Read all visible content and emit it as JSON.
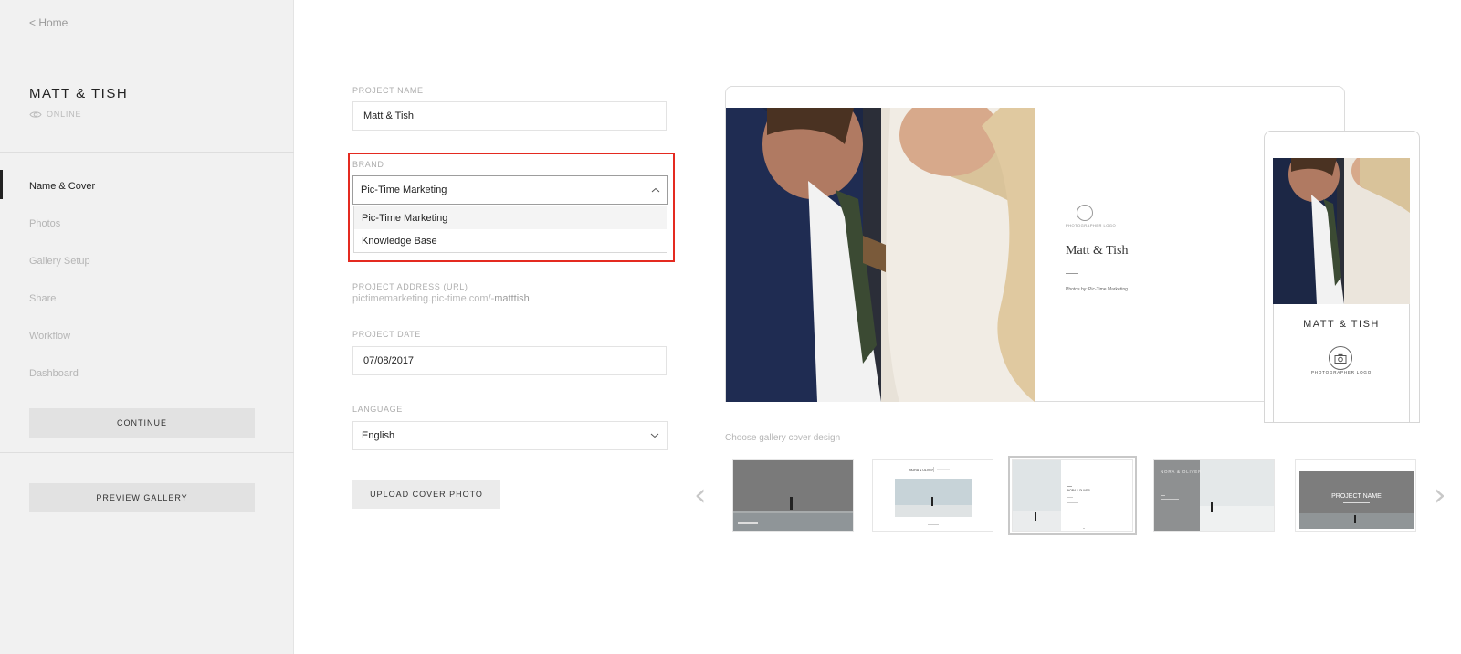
{
  "sidebar": {
    "home_link": "< Home",
    "project_title": "MATT & TISH",
    "status": "ONLINE",
    "nav": [
      {
        "label": "Name & Cover",
        "active": true
      },
      {
        "label": "Photos"
      },
      {
        "label": "Gallery Setup"
      },
      {
        "label": "Share"
      },
      {
        "label": "Workflow"
      },
      {
        "label": "Dashboard"
      }
    ],
    "continue_label": "CONTINUE",
    "preview_label": "PREVIEW GALLERY"
  },
  "form": {
    "project_name_label": "PROJECT NAME",
    "project_name_value": "Matt & Tish",
    "brand_label": "BRAND",
    "brand_value": "Pic-Time Marketing",
    "brand_options": [
      "Pic-Time Marketing",
      "Knowledge Base"
    ],
    "address_label": "PROJECT ADDRESS (URL)",
    "address_prefix": "pictimemarketing.pic-time.com/-",
    "address_slug": "matttish",
    "date_label": "PROJECT DATE",
    "date_value": "07/08/2017",
    "language_label": "LANGUAGE",
    "language_value": "English",
    "upload_label": "UPLOAD COVER PHOTO"
  },
  "preview": {
    "desktop_logo_caption": "PHOTOGRAPHER LOGO",
    "desktop_title": "Matt & Tish",
    "desktop_byline": "Photos by: Pic-Time Marketing",
    "mobile_title": "MATT & TISH",
    "mobile_logo_caption": "PHOTOGRAPHER LOGO",
    "choose_label": "Choose gallery cover design",
    "thumbnails": [
      {
        "name": "cover-design-1"
      },
      {
        "name": "cover-design-2",
        "text": "NORA & OLIVER"
      },
      {
        "name": "cover-design-3",
        "text": "NORA & OLIVER",
        "selected": true
      },
      {
        "name": "cover-design-4",
        "text": "NORA & OLIVER"
      },
      {
        "name": "cover-design-5",
        "text": "PROJECT NAME"
      }
    ]
  },
  "colors": {
    "sidebar_bg": "#f1f1f1",
    "highlight": "#e42a20",
    "accent_dark": "#222222"
  }
}
